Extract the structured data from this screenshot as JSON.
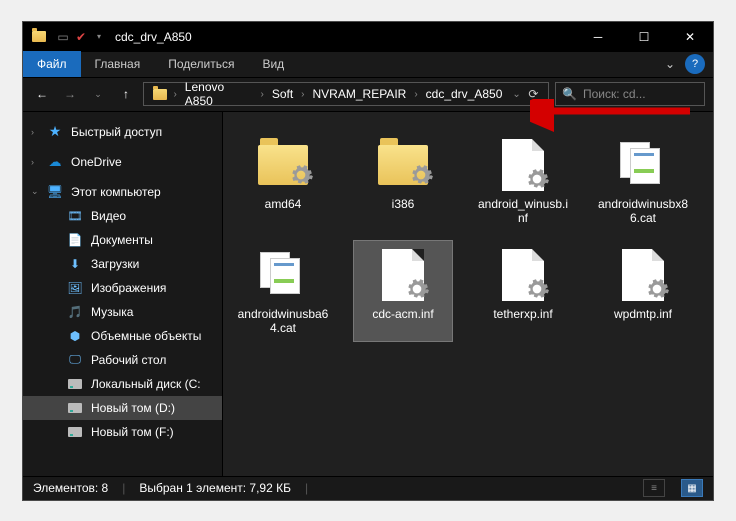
{
  "title": "cdc_drv_A850",
  "ribbon": {
    "file": "Файл",
    "home": "Главная",
    "share": "Поделиться",
    "view": "Вид"
  },
  "breadcrumb": [
    "Lenovo A850",
    "Soft",
    "NVRAM_REPAIR",
    "cdc_drv_A850"
  ],
  "search_placeholder": "Поиск: cd...",
  "nav": {
    "quick": "Быстрый доступ",
    "onedrive": "OneDrive",
    "thispc": "Этот компьютер",
    "items": [
      {
        "label": "Видео"
      },
      {
        "label": "Документы"
      },
      {
        "label": "Загрузки"
      },
      {
        "label": "Изображения"
      },
      {
        "label": "Музыка"
      },
      {
        "label": "Объемные объекты"
      },
      {
        "label": "Рабочий стол"
      },
      {
        "label": "Локальный диск (C:"
      },
      {
        "label": "Новый том (D:)"
      },
      {
        "label": "Новый том (F:)"
      }
    ]
  },
  "files": [
    {
      "label": "amd64",
      "type": "folder"
    },
    {
      "label": "i386",
      "type": "folder"
    },
    {
      "label": "android_winusb.inf",
      "type": "inf"
    },
    {
      "label": "androidwinusbx86.cat",
      "type": "cat"
    },
    {
      "label": "androidwinusba64.cat",
      "type": "cat"
    },
    {
      "label": "cdc-acm.inf",
      "type": "inf",
      "selected": true
    },
    {
      "label": "tetherxp.inf",
      "type": "inf"
    },
    {
      "label": "wpdmtp.inf",
      "type": "inf"
    }
  ],
  "status": {
    "count": "Элементов: 8",
    "selected": "Выбран 1 элемент: 7,92 КБ"
  }
}
